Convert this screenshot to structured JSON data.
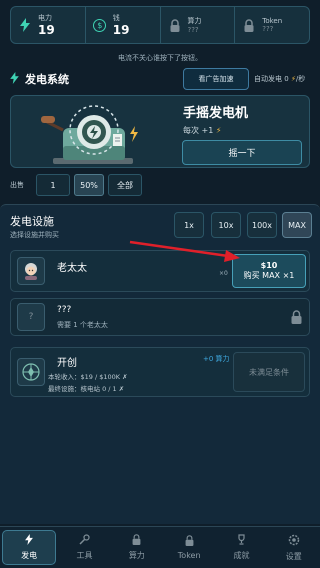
{
  "stats": [
    {
      "label": "电力",
      "value": "19",
      "icon": "bolt-icon"
    },
    {
      "label": "钱",
      "value": "19",
      "icon": "dollar-coin-icon"
    },
    {
      "label": "算力",
      "value": "???",
      "icon": "lock-icon"
    },
    {
      "label": "Token",
      "value": "???",
      "icon": "lock-icon"
    }
  ],
  "notice": "电流不关心谁按下了按钮。",
  "system": {
    "title": "发电系统",
    "ad_button": "看广告加速",
    "auto_prefix": "自动发电",
    "auto_value": "0",
    "auto_suffix": "/秒"
  },
  "generator": {
    "title": "手摇发电机",
    "per_label": "每次 +1",
    "crank_button": "摇一下"
  },
  "sell": {
    "label": "出售",
    "options": [
      "1",
      "50%",
      "全部"
    ],
    "selected": "50%"
  },
  "facilities": {
    "title": "发电设施",
    "subtitle": "选择设施并购买",
    "multipliers": [
      "1x",
      "10x",
      "100x",
      "MAX"
    ],
    "selected_multiplier": "MAX",
    "items": [
      {
        "name": "老太太",
        "owned": "×0",
        "price": "$10",
        "buy_label": "购买 MAX ×1"
      },
      {
        "name": "???",
        "requirement": "需要 1 个老太太"
      },
      {
        "name": "开创",
        "bonus": "+0 算力",
        "line1": "本轮收入：$19 / $100K ✗",
        "line2": "最终设施：核电站 0 / 1 ✗",
        "status": "未满足条件"
      }
    ]
  },
  "nav": [
    {
      "label": "发电",
      "icon": "bolt-icon",
      "active": true
    },
    {
      "label": "工具",
      "icon": "wrench-icon",
      "active": false
    },
    {
      "label": "算力",
      "icon": "lock-icon",
      "active": false
    },
    {
      "label": "Token",
      "icon": "lock-icon",
      "active": false
    },
    {
      "label": "成就",
      "icon": "trophy-icon",
      "active": false
    },
    {
      "label": "设置",
      "icon": "gear-icon",
      "active": false
    }
  ],
  "colors": {
    "accent": "#3fd3b4",
    "bolt": "#f0b944",
    "arrow": "#e0202a",
    "background": "#0f1e2a"
  }
}
